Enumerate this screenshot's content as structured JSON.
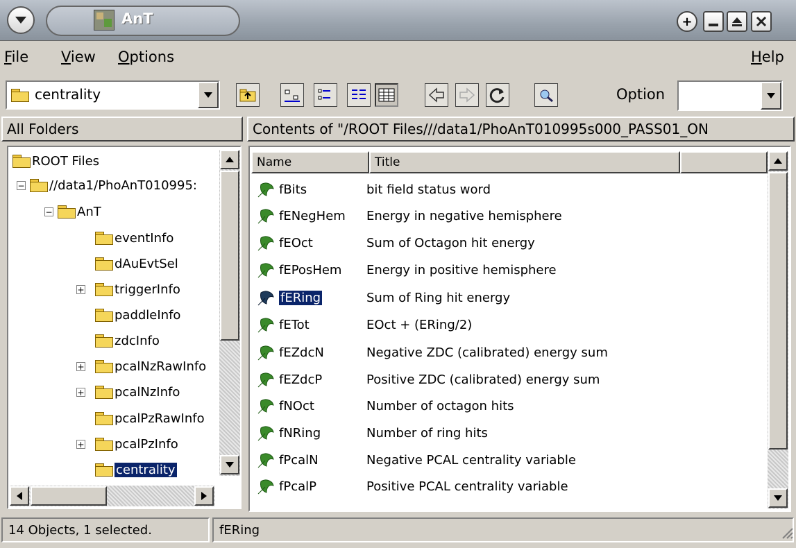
{
  "window": {
    "title": "AnT",
    "buttons": {
      "add": "+",
      "minimize": "_",
      "maximize": "▲",
      "close": "X"
    }
  },
  "menubar": {
    "file": "ile",
    "file_u": "F",
    "view": "iew",
    "view_u": "V",
    "options": "ptions",
    "options_u": "O",
    "help": "elp",
    "help_u": "H"
  },
  "toolbar": {
    "location": "centrality",
    "option_label": "Option",
    "option_value": ""
  },
  "folders_panel": {
    "header": "All Folders"
  },
  "contents_panel": {
    "header": "Contents of \"/ROOT Files///data1/PhoAnT010995s000_PASS01_ON"
  },
  "tree": [
    {
      "label": "ROOT Files",
      "expander": ""
    },
    {
      "label": "//data1/PhoAnT010995:",
      "expander": "−"
    },
    {
      "label": "AnT",
      "expander": "−"
    },
    {
      "label": "eventInfo",
      "expander": ""
    },
    {
      "label": "dAuEvtSel",
      "expander": ""
    },
    {
      "label": "triggerInfo",
      "expander": "+"
    },
    {
      "label": "paddleInfo",
      "expander": ""
    },
    {
      "label": "zdcInfo",
      "expander": ""
    },
    {
      "label": "pcalNzRawInfo",
      "expander": "+"
    },
    {
      "label": "pcalNzInfo",
      "expander": "+"
    },
    {
      "label": "pcalPzRawInfo",
      "expander": ""
    },
    {
      "label": "pcalPzInfo",
      "expander": "+"
    },
    {
      "label": "centrality",
      "expander": ""
    }
  ],
  "columns": {
    "name": "Name",
    "title": "Title"
  },
  "rows": [
    {
      "name": "fBits",
      "title": "bit field status word"
    },
    {
      "name": "fENegHem",
      "title": "Energy in negative hemisphere"
    },
    {
      "name": "fEOct",
      "title": "Sum of Octagon hit energy"
    },
    {
      "name": "fEPosHem",
      "title": "Energy in positive hemisphere"
    },
    {
      "name": "fERing",
      "title": "Sum of Ring hit energy"
    },
    {
      "name": "fETot",
      "title": "EOct + (ERing/2)"
    },
    {
      "name": "fEZdcN",
      "title": "Negative ZDC (calibrated) energy sum"
    },
    {
      "name": "fEZdcP",
      "title": "Positive ZDC (calibrated) energy sum"
    },
    {
      "name": "fNOct",
      "title": "Number of octagon hits"
    },
    {
      "name": "fNRing",
      "title": "Number of ring hits"
    },
    {
      "name": "fPcalN",
      "title": "Negative PCAL centrality variable"
    },
    {
      "name": "fPcalP",
      "title": "Positive PCAL centrality variable"
    }
  ],
  "status": {
    "count": "14 Objects, 1 selected.",
    "selected": "fERing"
  },
  "colors": {
    "selection": "#0a246a",
    "leaf": "#3a8a2a",
    "folder": "#f5d65a"
  }
}
